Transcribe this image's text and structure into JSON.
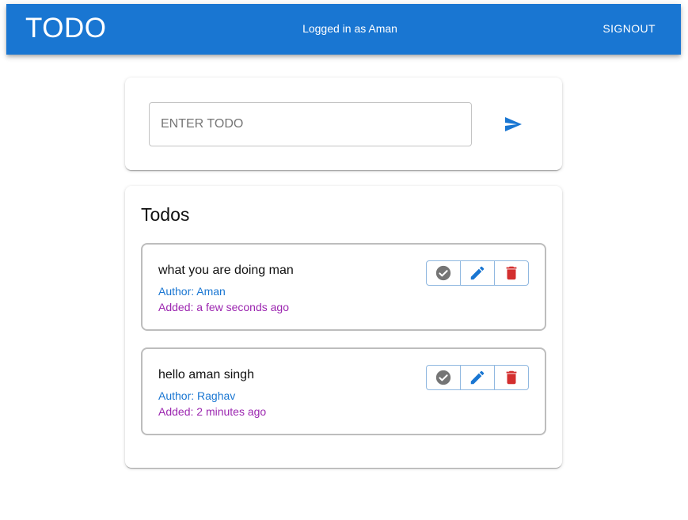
{
  "header": {
    "title": "TODO",
    "user_status": "Logged in as Aman",
    "signout_label": "SIGNOUT",
    "bg_color": "#1976d2"
  },
  "composer": {
    "placeholder": "ENTER TODO",
    "value": "",
    "send_icon": "send-icon"
  },
  "todos": {
    "heading": "Todos",
    "items": [
      {
        "text": "what you are doing man",
        "author": "Author: Aman",
        "added": "Added: a few seconds ago",
        "actions": [
          "check-circle-icon",
          "edit-pencil-icon",
          "delete-trash-icon"
        ]
      },
      {
        "text": "hello aman singh",
        "author": "Author: Raghav",
        "added": "Added: 2 minutes ago",
        "actions": [
          "check-circle-icon",
          "edit-pencil-icon",
          "delete-trash-icon"
        ]
      }
    ]
  },
  "colors": {
    "primary": "#1976d2",
    "author": "#1976d2",
    "added": "#9c27b0",
    "done_icon": "#757575",
    "delete_icon": "#d32f2f"
  }
}
